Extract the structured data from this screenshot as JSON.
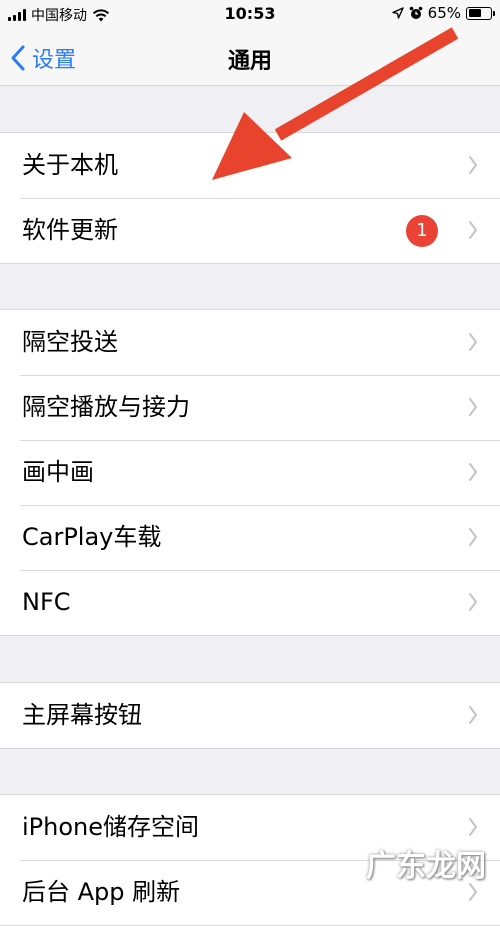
{
  "status_bar": {
    "carrier": "中国移动",
    "time": "10:53",
    "battery": "65%",
    "battery_level": 0.65
  },
  "nav": {
    "back_label": "设置",
    "title": "通用"
  },
  "groups": [
    {
      "items": [
        "关于本机",
        "软件更新"
      ]
    },
    {
      "items": [
        "隔空投送",
        "隔空播放与接力",
        "画中画",
        "CarPlay车载",
        "NFC"
      ]
    },
    {
      "items": [
        "主屏幕按钮"
      ]
    },
    {
      "items": [
        "iPhone储存空间",
        "后台 App 刷新"
      ]
    }
  ],
  "software_update_badge": "1",
  "annotation": {
    "color": "#e8442d"
  },
  "watermark": "广东龙网"
}
